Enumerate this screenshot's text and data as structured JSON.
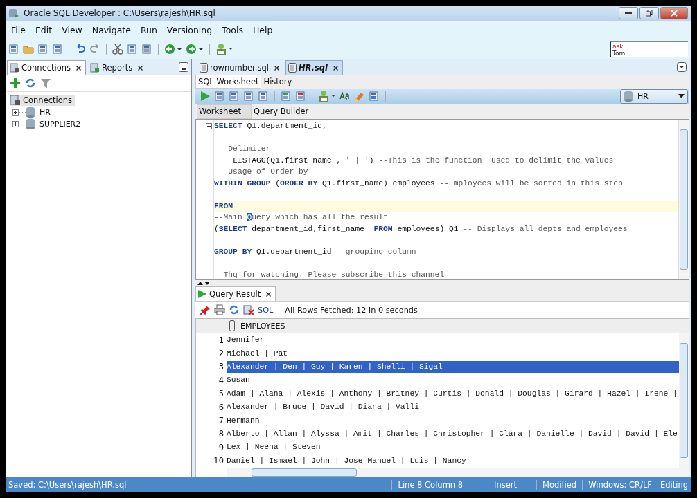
{
  "window": {
    "title": "Oracle SQL Developer : C:\\Users\\rajesh\\HR.sql"
  },
  "menu": [
    "File",
    "Edit",
    "View",
    "Navigate",
    "Run",
    "Versioning",
    "Tools",
    "Help"
  ],
  "ask_tom": {
    "top": "ask",
    "bottom": "Tom"
  },
  "left_panel": {
    "tabs": [
      {
        "label": "Connections",
        "selected": true
      },
      {
        "label": "Reports",
        "selected": false
      }
    ],
    "tree": [
      {
        "label": "Connections",
        "selected": true,
        "children": [
          {
            "label": "HR",
            "expanded": false,
            "selected": false
          },
          {
            "label": "SUPPLIER2",
            "expanded": false,
            "selected": false
          }
        ]
      }
    ]
  },
  "editor_tabs": [
    {
      "label": "rownumber.sql",
      "selected": false
    },
    {
      "label": "HR.sql",
      "selected": true
    }
  ],
  "sub_tabs": [
    {
      "label": "SQL Worksheet",
      "selected": true
    },
    {
      "label": "History",
      "selected": false
    }
  ],
  "connection": "HR",
  "worksheet_tabs": [
    {
      "label": "Worksheet",
      "selected": true
    },
    {
      "label": "Query Builder",
      "selected": false
    }
  ],
  "code": [
    {
      "current": false,
      "segments": [
        {
          "kind": "kw",
          "text": "SELECT"
        },
        {
          "kind": "text",
          "text": " Q1.department_id,"
        }
      ]
    },
    {
      "current": false
    },
    {
      "current": false,
      "segments": [
        {
          "kind": "comment",
          "text": "-- Delimiter"
        }
      ]
    },
    {
      "current": false,
      "segments": [
        {
          "kind": "text",
          "text": "    LISTAGG(Q1.first_name , ' | ') "
        },
        {
          "kind": "comment",
          "text": "--This is the function  used to delimit the values"
        }
      ]
    },
    {
      "current": false,
      "segments": [
        {
          "kind": "comment",
          "text": "-- Usage of Order by"
        }
      ]
    },
    {
      "current": false,
      "segments": [
        {
          "kind": "kw",
          "text": "WITHIN GROUP"
        },
        {
          "kind": "text",
          "text": " ("
        },
        {
          "kind": "kw",
          "text": "ORDER BY"
        },
        {
          "kind": "text",
          "text": " Q1.first_name) employees "
        },
        {
          "kind": "comment",
          "text": "--Employees will be sorted in this step"
        }
      ]
    },
    {
      "current": false
    },
    {
      "current": true,
      "segments": [
        {
          "kind": "kw",
          "text": "FROM"
        }
      ]
    },
    {
      "current": false,
      "segments": [
        {
          "kind": "comment",
          "text": "--Main "
        },
        {
          "kind": "selected",
          "text": "Q"
        },
        {
          "kind": "comment",
          "text": "uery which has all the result"
        }
      ]
    },
    {
      "current": false,
      "segments": [
        {
          "kind": "text",
          "text": "("
        },
        {
          "kind": "kw",
          "text": "SELECT"
        },
        {
          "kind": "text",
          "text": " department_id,first_name  "
        },
        {
          "kind": "kw",
          "text": "FROM"
        },
        {
          "kind": "text",
          "text": " employees) Q1 "
        },
        {
          "kind": "comment",
          "text": "-- Displays all depts and employees"
        }
      ]
    },
    {
      "current": false
    },
    {
      "current": false,
      "segments": [
        {
          "kind": "kw",
          "text": "GROUP BY"
        },
        {
          "kind": "text",
          "text": " Q1.department_id "
        },
        {
          "kind": "comment",
          "text": "--grouping column"
        }
      ]
    },
    {
      "current": false
    },
    {
      "current": false,
      "segments": [
        {
          "kind": "comment",
          "text": "--Thq for watching. Please subscribe this channel"
        }
      ]
    }
  ],
  "result": {
    "tab": "Query Result",
    "sql_link": "SQL",
    "fetch_status": "All Rows Fetched: 12 in 0 seconds",
    "column": "EMPLOYEES",
    "rows": [
      {
        "number": "1",
        "value": "Jennifer",
        "selected": false
      },
      {
        "number": "2",
        "value": "Michael | Pat",
        "selected": false
      },
      {
        "number": "3",
        "value": "Alexander | Den | Guy | Karen | Shelli | Sigal",
        "selected": true
      },
      {
        "number": "4",
        "value": "Susan",
        "selected": false
      },
      {
        "number": "5",
        "value": "Adam | Alana | Alexis | Anthony | Britney | Curtis | Donald | Douglas | Girard | Hazel | Irene |",
        "selected": false
      },
      {
        "number": "6",
        "value": "Alexander | Bruce | David | Diana | Valli",
        "selected": false
      },
      {
        "number": "7",
        "value": "Hermann",
        "selected": false
      },
      {
        "number": "8",
        "value": "Alberto | Allan | Alyssa | Amit | Charles | Christopher | Clara | Danielle | David | David | Ele",
        "selected": false
      },
      {
        "number": "9",
        "value": "Lex | Neena | Steven",
        "selected": false
      },
      {
        "number": "10",
        "value": "Daniel | Ismael | John | Jose Manuel | Luis | Nancy",
        "selected": false
      }
    ]
  },
  "status_bar": {
    "message": "Saved: C:\\Users\\rajesh\\HR.sql",
    "position": "Line 8 Column 8",
    "mode": "Insert",
    "state": "Modified",
    "line_endings": "Windows: CR/LF",
    "activity": "Editing"
  }
}
